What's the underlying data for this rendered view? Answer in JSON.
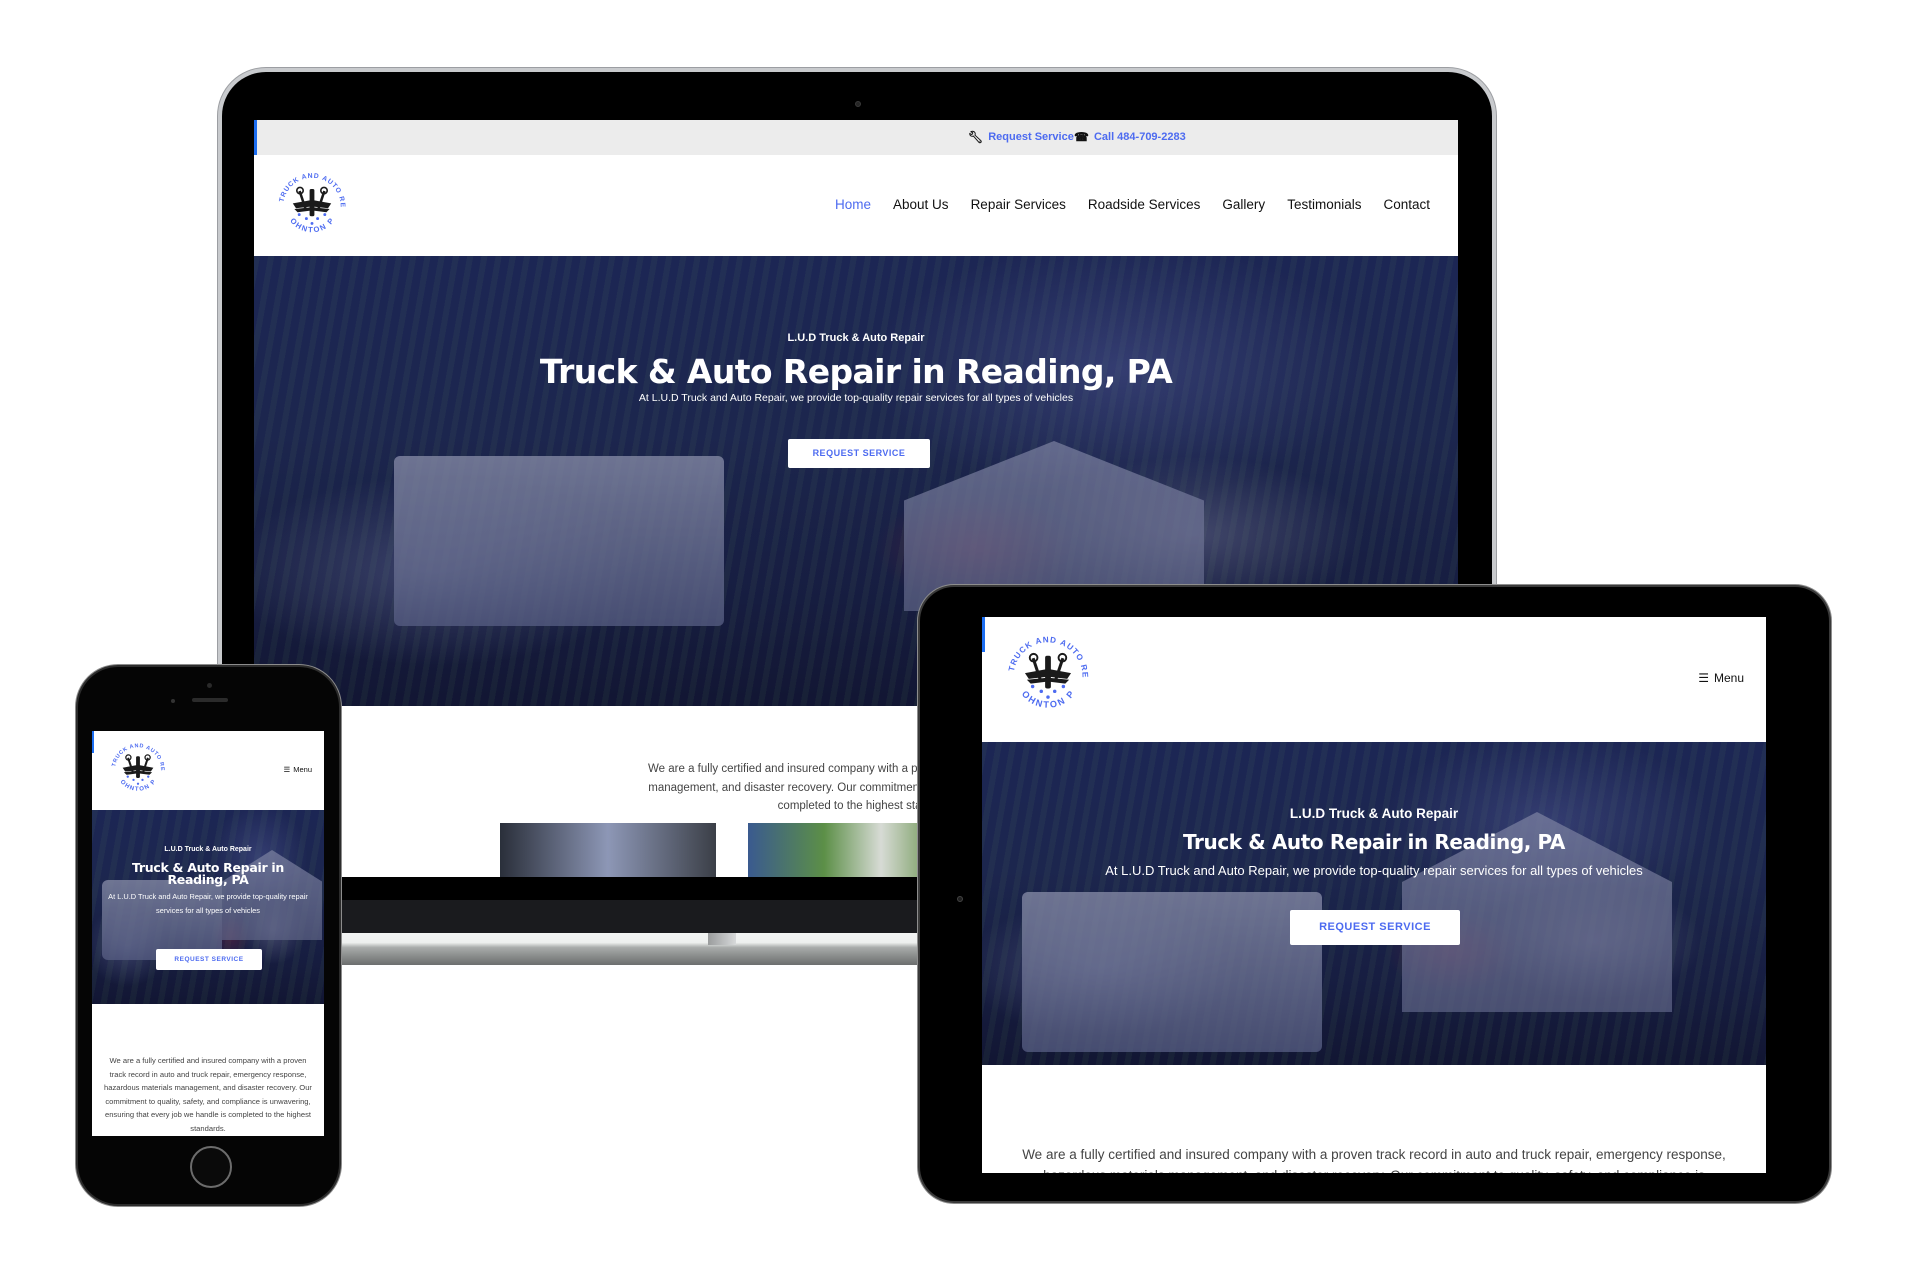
{
  "site": {
    "brand": "L.U.D Truck & Auto Repair",
    "logo": {
      "ring_top": "L.U.D TRUCK AND AUTO REPAIR",
      "ring_bottom": "MOHNTON PA",
      "colors": {
        "ring_text": "#4d6bf0",
        "emblem": "#1a1a1a"
      }
    },
    "topbar": {
      "request_service": {
        "icon": "wrench-icon",
        "label": "Request Service"
      },
      "call": {
        "icon": "phone-icon",
        "label": "Call 484-709-2283"
      }
    },
    "nav": [
      {
        "label": "Home",
        "active": true
      },
      {
        "label": "About Us",
        "active": false
      },
      {
        "label": "Repair Services",
        "active": false
      },
      {
        "label": "Roadside Services",
        "active": false
      },
      {
        "label": "Gallery",
        "active": false
      },
      {
        "label": "Testimonials",
        "active": false
      },
      {
        "label": "Contact",
        "active": false
      }
    ],
    "menu_toggle": {
      "icon": "hamburger-icon",
      "label": "Menu"
    },
    "hero": {
      "eyebrow": "L.U.D Truck & Auto Repair",
      "title": "Truck & Auto Repair in Reading, PA",
      "subtitle": "At L.U.D Truck and Auto Repair, we provide top-quality repair services for all types of vehicles",
      "cta": "REQUEST SERVICE"
    },
    "intro": {
      "full": "We are a fully certified and insured company with a proven track record in auto and truck repair, emergency response, hazardous materials management, and disaster recovery. Our commitment to quality, safety, and compliance is unwavering, ensuring that every job we handle is completed to the highest standards."
    },
    "colors": {
      "accent": "#4d6bf0",
      "accent_bar": "#1c6ef2",
      "topbar_bg": "#ececec",
      "body_text": "#444444"
    }
  },
  "devices": {
    "laptop": {
      "visible_intro_lines": [
        "We are a fully certified and insured company with a proven track record in auto an",
        "management, and disaster recovery. Our commitment to quality, safety, and comp",
        "completed to the highest stand"
      ]
    },
    "tablet": {
      "visible_intro_lines": [
        "We are a fully certified and insured company with a proven track record in auto and truck repair, emergency response,",
        "hazardous materials management, and disaster recovery. Our commitment to quality, safety, and compliance is"
      ]
    },
    "phone": {
      "visible_intro_lines": [
        "We are a fully certified and insured company with a proven track record in auto and truck repair, emergency response, hazardous materials management, and disaster recovery. Our commitment to quality, safety, and compliance is unwavering, ensuring that every job we handle is completed to the highest standards."
      ]
    }
  }
}
